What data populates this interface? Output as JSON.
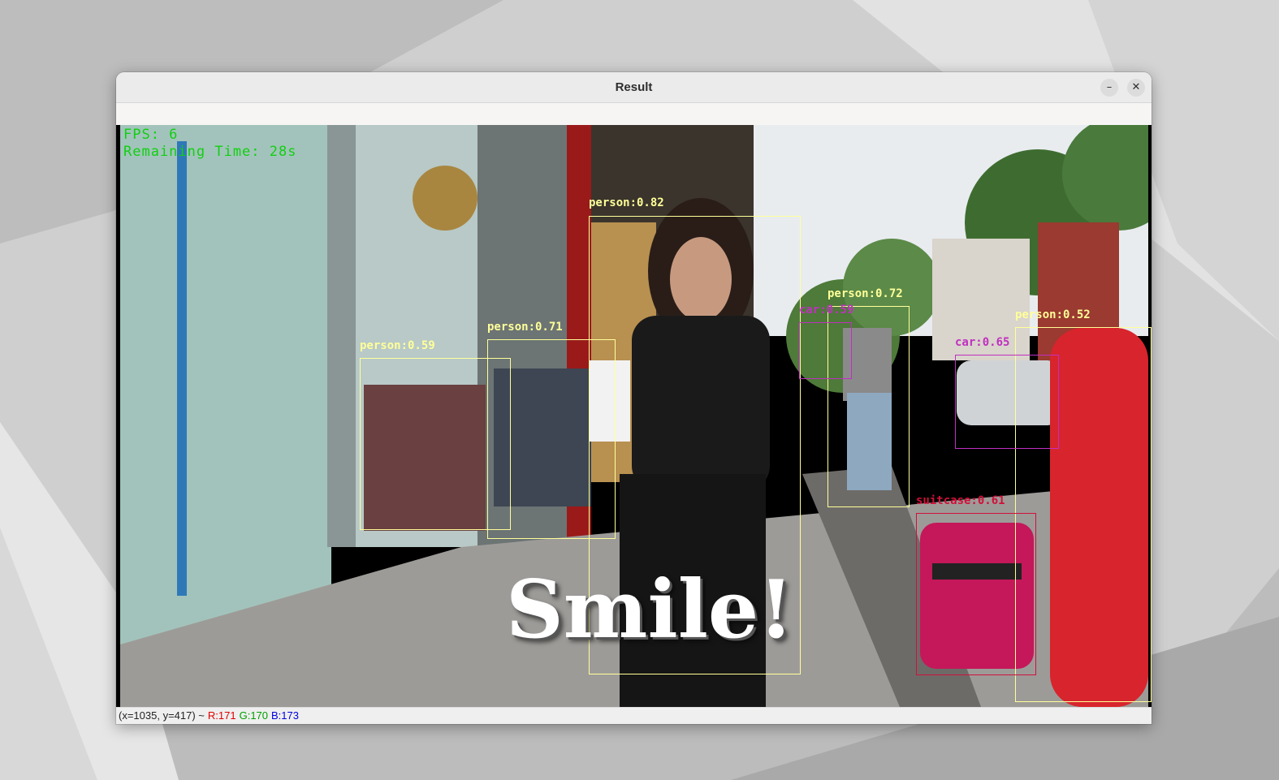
{
  "window": {
    "title": "Result",
    "minimize_symbol": "–",
    "close_symbol": "✕"
  },
  "overlay": {
    "fps": "FPS: 6",
    "remaining": "Remaining Time: 28s"
  },
  "detections": [
    {
      "label": "person:0.82",
      "color": "#ffff99"
    },
    {
      "label": "person:0.71",
      "color": "#ffff99"
    },
    {
      "label": "person:0.59",
      "color": "#ffff99"
    },
    {
      "label": "person:0.72",
      "color": "#ffff99"
    },
    {
      "label": "person:0.52",
      "color": "#ffff99"
    },
    {
      "label": "car:0.59",
      "color": "#c030c0"
    },
    {
      "label": "car:0.65",
      "color": "#c030c0"
    },
    {
      "label": "suitcase:0.61",
      "color": "#d0103a"
    }
  ],
  "caption": "Smile!",
  "status": {
    "coords": "(x=1035, y=417) ~",
    "r": "R:171",
    "g": "G:170",
    "b": "B:173",
    "r_color": "#e00000",
    "g_color": "#00a000",
    "b_color": "#0000e0"
  }
}
